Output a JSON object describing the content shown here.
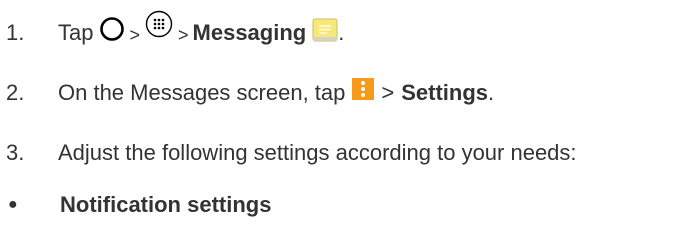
{
  "steps": [
    {
      "number": "1.",
      "text_before": "Tap",
      "separator1": ">",
      "separator2": ">",
      "bold_text": "Messaging",
      "trailing": "."
    },
    {
      "number": "2.",
      "text_before": "On the Messages screen, tap",
      "separator": ">",
      "bold_text": "Settings",
      "trailing": "."
    },
    {
      "number": "3.",
      "text": "Adjust the following settings according to your needs:"
    }
  ],
  "bullet": {
    "symbol": "●",
    "bold_text": "Notification settings"
  },
  "icons": {
    "home": "home-circle-icon",
    "apps": "apps-grid-icon",
    "messaging": "messaging-app-icon",
    "menu": "menu-more-icon"
  },
  "colors": {
    "text": "#333333",
    "messaging_icon": "#f7e87a",
    "menu_icon": "#f59a1b"
  }
}
